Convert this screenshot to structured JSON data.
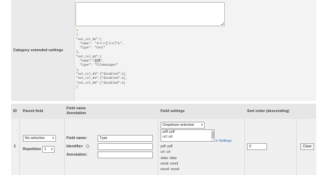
{
  "category_settings": {
    "label": "Category extended settings",
    "textarea_value": "",
    "json_lines": [
      "{",
      "\"ext_col_01\":{",
      "  \"name\": \"メインビジュアル\",",
      "  \"type\": \"text\"",
      "},",
      "\"ext_col_02\":{",
      "  \"name\":\"画像\",",
      "  \"type\": \"filemanager\"",
      "},",
      "\"ext_col_03\":{\"disabled\":1},",
      "\"ext_col_04\":{\"disabled\":1},",
      "\"ext_col_05\":{\"disabled\":1}",
      "}"
    ],
    "json_lead": "0"
  },
  "grid": {
    "headers": {
      "id": "ID",
      "parent": "Parent field",
      "field_name": "Field name",
      "annotation": "Annotation",
      "field_settings": "Field settings",
      "sort_order": "Sort order (descending)"
    },
    "row": {
      "id": "1",
      "parent_select": "No selection",
      "repetition_label": "Repetition",
      "repetition_value": "1",
      "field_name_label": "Field name:",
      "field_name_value": "Type",
      "identifier_label": "Identifier:",
      "help_glyph": "?",
      "annotation_label": "Annotation:",
      "type_select": "Dropdown selection",
      "listbox_lines": [
        "pdf::pdf",
        "url::url"
      ],
      "settings_link": "Settings",
      "options": [
        "pdf: pdf",
        "url: url",
        "data: data",
        "word: word",
        "excel: excel"
      ],
      "sort_value": "0",
      "clear_button": "Clear"
    }
  }
}
